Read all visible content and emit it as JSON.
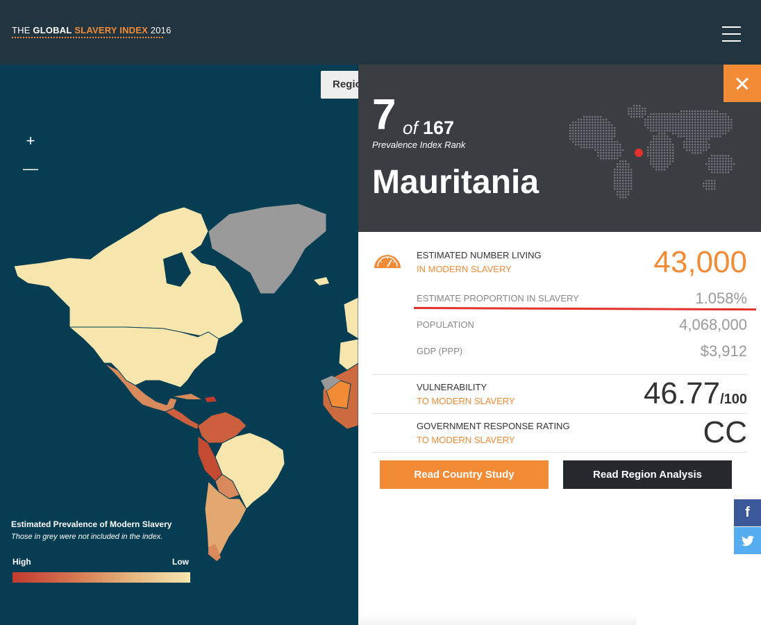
{
  "header": {
    "logo": {
      "the": "THE",
      "global": "GLOBAL",
      "slavery": "SLAVERY INDEX",
      "year": "2016"
    }
  },
  "map": {
    "region_button": "Regio",
    "zoom_in": "+",
    "zoom_out": "—",
    "legend": {
      "title": "Estimated Prevalence of Modern Slavery",
      "subtitle": "Those in grey were not included in the index.",
      "high": "High",
      "low": "Low"
    },
    "colors": {
      "ocean": "#063d52",
      "high": "#c23a2e",
      "low": "#f6e6ae",
      "excluded": "#9a9a9a"
    }
  },
  "panel": {
    "rank": "7",
    "of": "of",
    "total": "167",
    "rank_caption": "Prevalence Index Rank",
    "country": "Mauritania",
    "stats": {
      "living_label_1": "ESTIMATED NUMBER LIVING",
      "living_label_2": "IN MODERN SLAVERY",
      "living_value": "43,000",
      "proportion_label": "ESTIMATE PROPORTION IN SLAVERY",
      "proportion_value": "1.058%",
      "population_label": "POPULATION",
      "population_value": "4,068,000",
      "gdp_label": "GDP (PPP)",
      "gdp_value": "$3,912",
      "vuln_label_1": "VULNERABILITY",
      "vuln_label_2": "TO MODERN SLAVERY",
      "vuln_value": "46.77",
      "vuln_out_of": "/100",
      "gov_label_1": "GOVERNMENT RESPONSE RATING",
      "gov_label_2": "TO MODERN SLAVERY",
      "gov_value": "CC"
    },
    "buttons": {
      "study": "Read Country Study",
      "region": "Read Region Analysis"
    },
    "accent": "#f28b36"
  },
  "social": {
    "facebook": "f",
    "twitter": "🐦"
  }
}
